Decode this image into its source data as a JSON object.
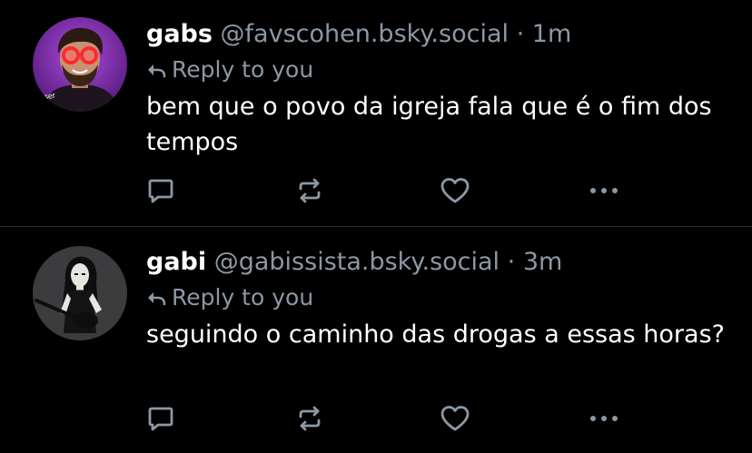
{
  "colors": {
    "background": "#000000",
    "text_primary": "#ffffff",
    "text_secondary": "#8b98a5",
    "divider": "#26303b"
  },
  "posts": [
    {
      "display_name": "gabs",
      "handle": "@favscohen.bsky.social",
      "separator": "·",
      "time": "1m",
      "reply_label": "Reply to you",
      "text": "bem que o povo da igreja fala que é o fim dos tempos",
      "avatar_text": "aiser"
    },
    {
      "display_name": "gabi",
      "handle": "@gabissista.bsky.social",
      "separator": "·",
      "time": "3m",
      "reply_label": "Reply to you",
      "text": "seguindo o caminho das drogas a essas horas?"
    }
  ],
  "icons": {
    "reply": "reply-arrow-icon",
    "comment": "comment-icon",
    "repost": "repost-icon",
    "like": "heart-icon",
    "more": "more-dots-icon"
  }
}
